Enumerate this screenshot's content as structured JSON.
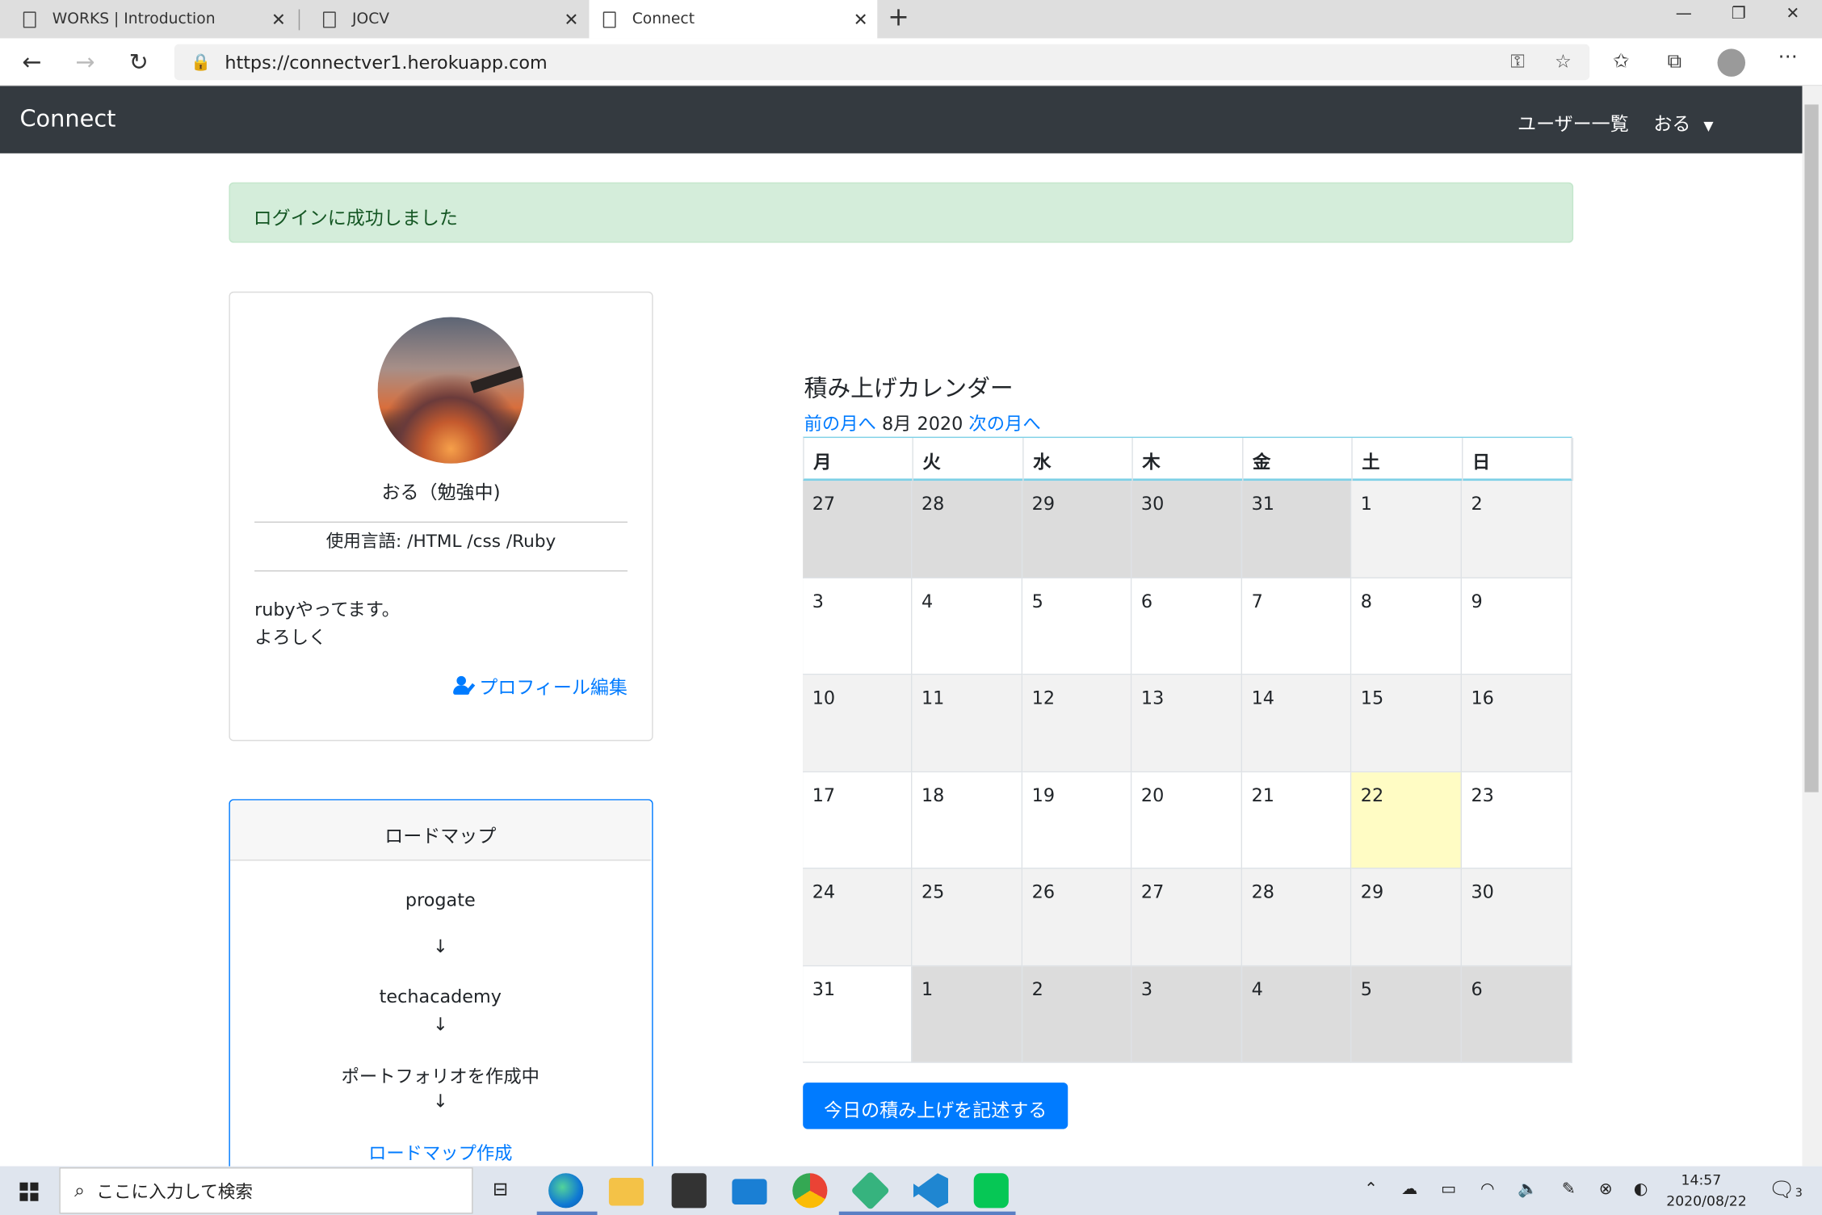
{
  "browser": {
    "tabs": [
      {
        "label": "WORKS | Introduction"
      },
      {
        "label": "JOCV"
      },
      {
        "label": "Connect"
      }
    ],
    "url": "https://connectver1.herokuapp.com"
  },
  "navbar": {
    "brand": "Connect",
    "users_link": "ユーザー一覧",
    "user_menu": "おる"
  },
  "alert": {
    "message": "ログインに成功しました"
  },
  "profile": {
    "name_status": "おる（勉強中)",
    "languages": "使用言語: /HTML /css /Ruby",
    "bio_line1": "rubyやってます。",
    "bio_line2": "よろしく",
    "edit_link": "プロフィール編集"
  },
  "roadmap": {
    "title": "ロードマップ",
    "steps": [
      "progate",
      "↓",
      "techacademy",
      "↓",
      "ポートフォリオを作成中",
      "↓"
    ],
    "create_link": "ロードマップ作成"
  },
  "calendar": {
    "title": "積み上げカレンダー",
    "prev_link": "前の月へ",
    "current_month": "8月 2020",
    "next_link": "次の月へ",
    "weekdays": [
      "月",
      "火",
      "水",
      "木",
      "金",
      "土",
      "日"
    ],
    "weeks": [
      [
        "27",
        "28",
        "29",
        "30",
        "31",
        "1",
        "2"
      ],
      [
        "3",
        "4",
        "5",
        "6",
        "7",
        "8",
        "9"
      ],
      [
        "10",
        "11",
        "12",
        "13",
        "14",
        "15",
        "16"
      ],
      [
        "17",
        "18",
        "19",
        "20",
        "21",
        "22",
        "23"
      ],
      [
        "24",
        "25",
        "26",
        "27",
        "28",
        "29",
        "30"
      ],
      [
        "31",
        "1",
        "2",
        "3",
        "4",
        "5",
        "6"
      ]
    ],
    "today": "22",
    "colors": {
      "outside_month": "#dcdcdc",
      "striped": "#f2f2f2",
      "today": "#fffcc4",
      "plain": "#ffffff"
    }
  },
  "record_button": "今日の積み上げを記述する",
  "taskbar": {
    "search_placeholder": "ここに入力して検索",
    "time": "14:57",
    "date": "2020/08/22",
    "notification_count": "3"
  }
}
